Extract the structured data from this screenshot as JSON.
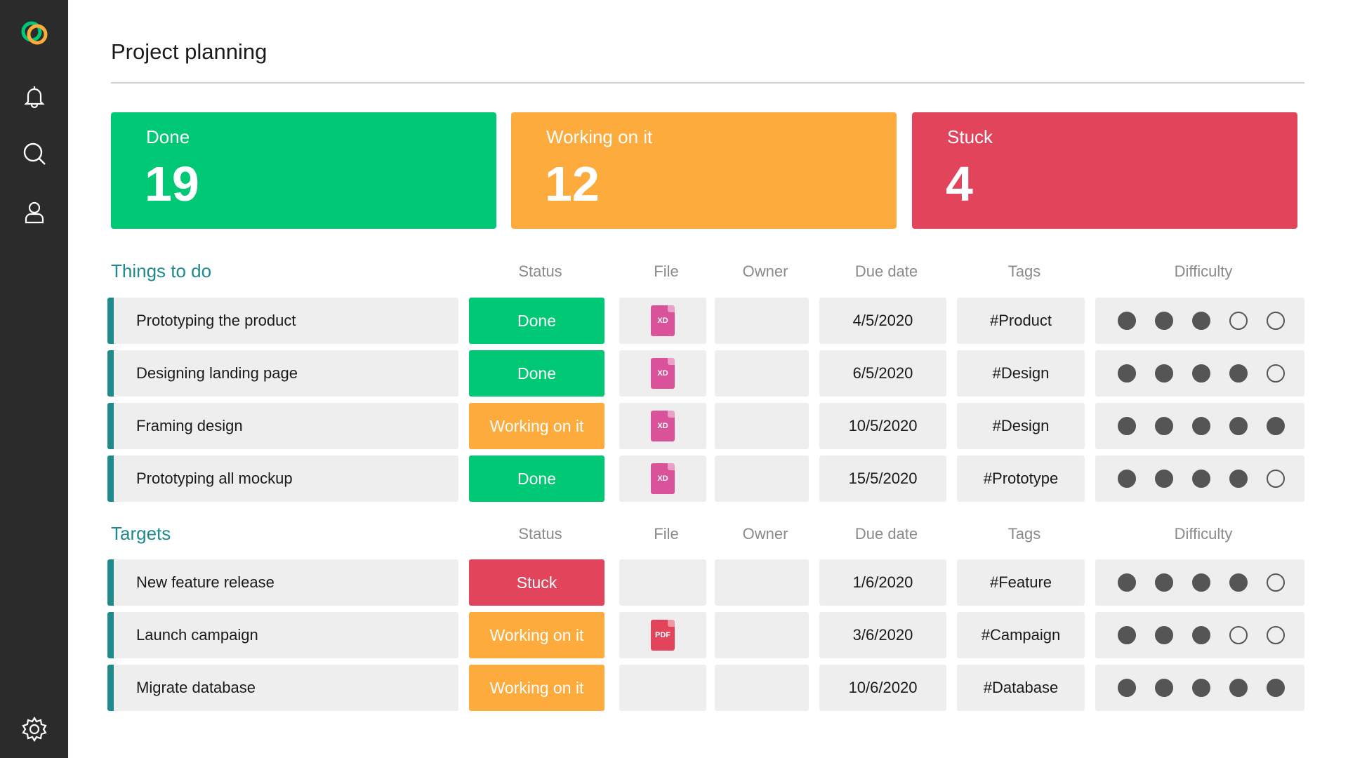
{
  "sidebar": {
    "icons": [
      "logo-icon",
      "bell-icon",
      "search-icon",
      "user-icon",
      "gear-icon"
    ]
  },
  "page": {
    "title": "Project planning"
  },
  "summary": [
    {
      "label": "Done",
      "count": "19",
      "color": "#00c875"
    },
    {
      "label": "Working on it",
      "count": "12",
      "color": "#fdab3d"
    },
    {
      "label": "Stuck",
      "count": "4",
      "color": "#e2445c"
    }
  ],
  "columns": {
    "status": "Status",
    "file": "File",
    "owner": "Owner",
    "due": "Due date",
    "tags": "Tags",
    "difficulty": "Difficulty"
  },
  "sections": [
    {
      "title": "Things to do",
      "rows": [
        {
          "task": "Prototyping the product",
          "status": "Done",
          "file": "XD",
          "due": "4/5/2020",
          "tag": "#Product",
          "difficulty": 3
        },
        {
          "task": "Designing landing page",
          "status": "Done",
          "file": "XD",
          "due": "6/5/2020",
          "tag": "#Design",
          "difficulty": 4
        },
        {
          "task": "Framing design",
          "status": "Working on it",
          "file": "XD",
          "due": "10/5/2020",
          "tag": "#Design",
          "difficulty": 5
        },
        {
          "task": "Prototyping all mockup",
          "status": "Done",
          "file": "XD",
          "due": "15/5/2020",
          "tag": "#Prototype",
          "difficulty": 4
        }
      ]
    },
    {
      "title": "Targets",
      "rows": [
        {
          "task": "New feature release",
          "status": "Stuck",
          "file": "",
          "due": "1/6/2020",
          "tag": "#Feature",
          "difficulty": 4
        },
        {
          "task": "Launch campaign",
          "status": "Working on it",
          "file": "PDF",
          "due": "3/6/2020",
          "tag": "#Campaign",
          "difficulty": 3
        },
        {
          "task": "Migrate database",
          "status": "Working on it",
          "file": "",
          "due": "10/6/2020",
          "tag": "#Database",
          "difficulty": 5
        }
      ]
    }
  ],
  "colors": {
    "accent": "#1f8a8c",
    "done": "#00c875",
    "working": "#fdab3d",
    "stuck": "#e2445c",
    "xd_file": "#d9529a",
    "pdf_file": "#e2445c",
    "sidebar": "#2b2b2b"
  }
}
